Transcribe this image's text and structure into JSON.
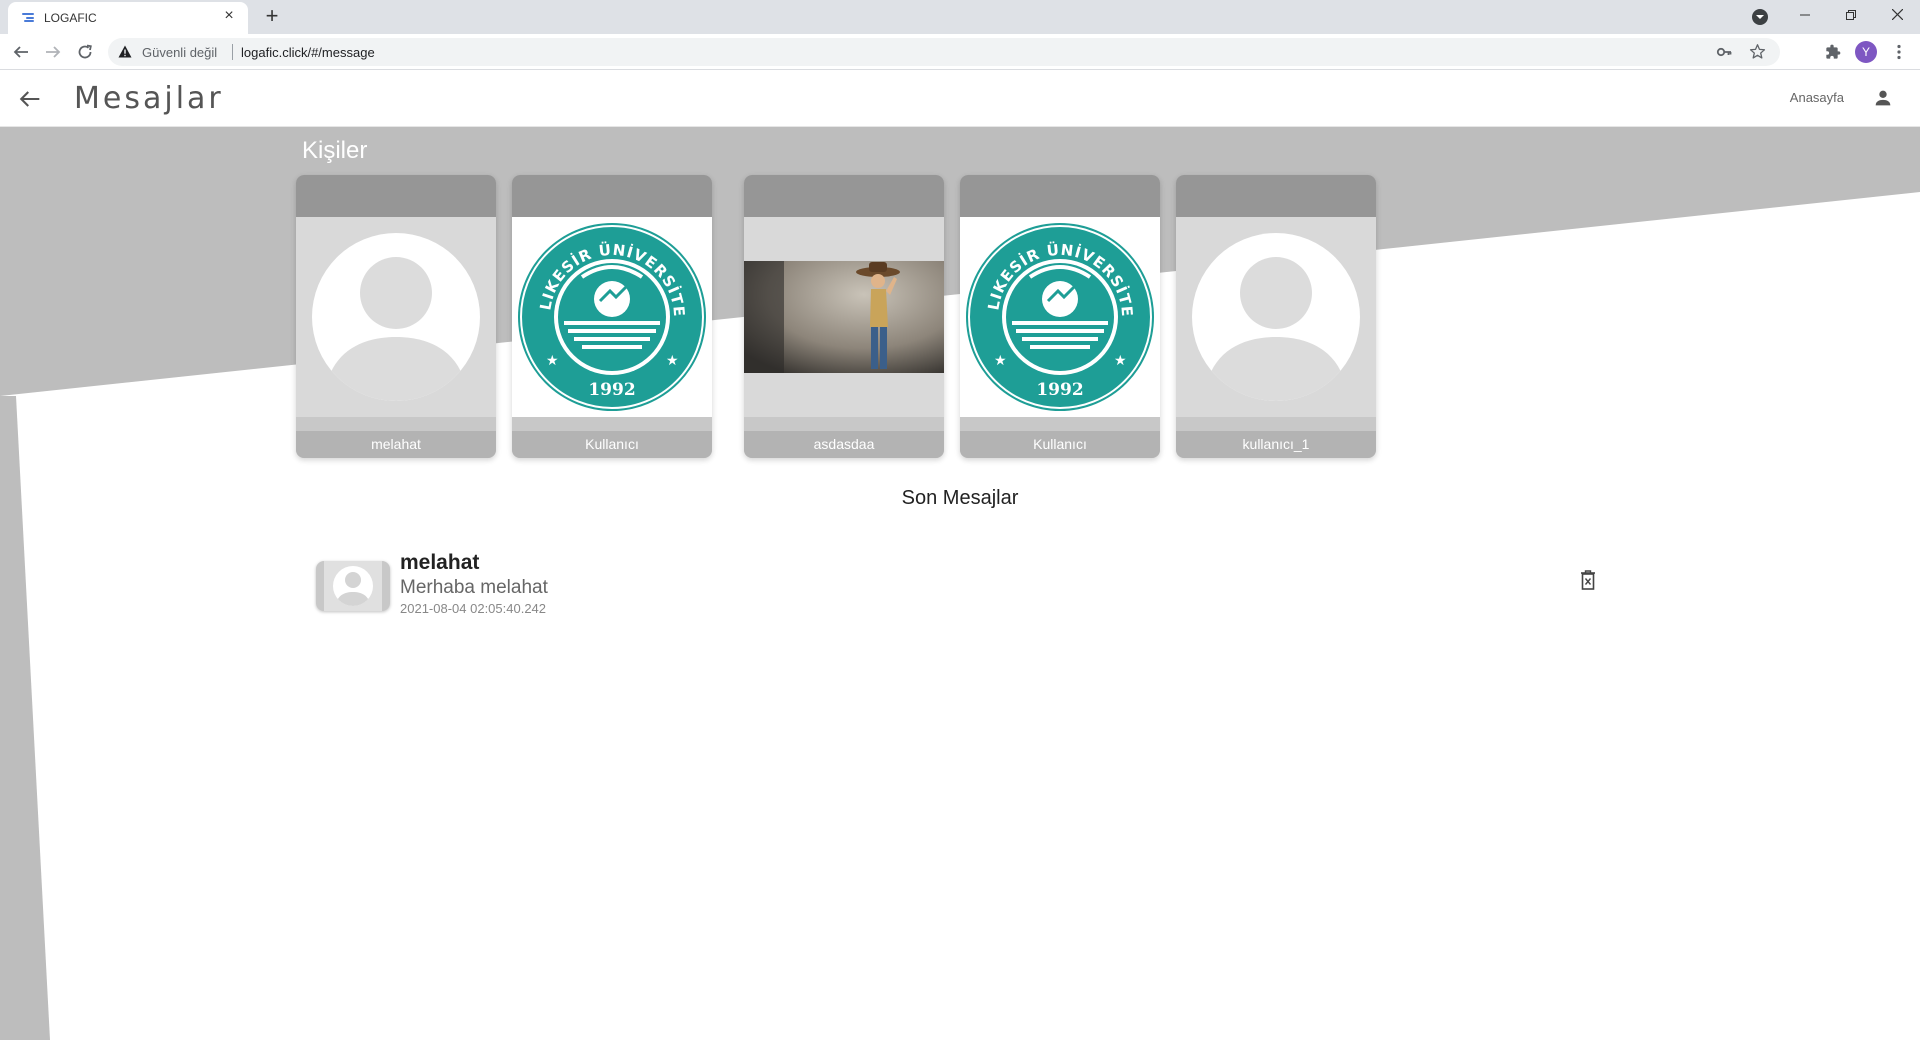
{
  "browser": {
    "tab_title": "LOGAFIC",
    "tab_close": "×",
    "new_tab": "+",
    "security_label": "Güvenli değil",
    "url": "logafic.click/#/message",
    "profile_initial": "Y"
  },
  "header": {
    "title": "Mesajlar",
    "home_link": "Anasayfa"
  },
  "contacts": {
    "title": "Kişiler",
    "items": [
      {
        "name": "melahat",
        "picture": "default-avatar"
      },
      {
        "name": "Kullanıcı",
        "picture": "university-seal"
      },
      {
        "name": "asdasdaa",
        "picture": "photo"
      },
      {
        "name": "Kullanıcı",
        "picture": "university-seal"
      },
      {
        "name": "kullanıcı_1",
        "picture": "default-avatar"
      }
    ]
  },
  "seal": {
    "arc_text": "BALIKESİR ÜNİVERSİTESİ",
    "year": "1992",
    "color": "#1e9e96"
  },
  "recent": {
    "title": "Son Mesajlar",
    "messages": [
      {
        "sender": "melahat",
        "text": "Merhaba melahat",
        "time": "2021-08-04 02:05:40.242"
      }
    ]
  },
  "colors": {
    "page_bg_shape": "#bdbdbd",
    "card_cap": "#969696",
    "card_name_bar": "#b3b3b3",
    "seal_teal": "#1e9e96"
  }
}
